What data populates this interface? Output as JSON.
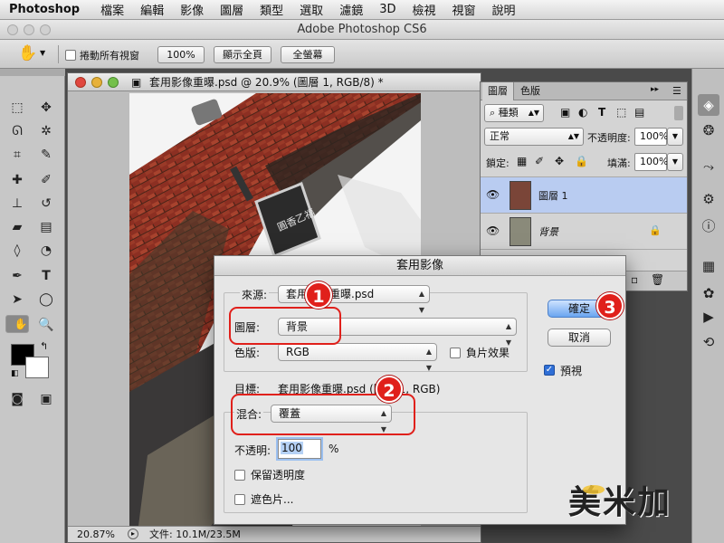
{
  "menubar": {
    "app": "Photoshop",
    "items": [
      "檔案",
      "編輯",
      "影像",
      "圖層",
      "類型",
      "選取",
      "濾鏡",
      "3D",
      "檢視",
      "視窗",
      "說明"
    ]
  },
  "window": {
    "title": "Adobe Photoshop CS6"
  },
  "options_bar": {
    "scroll_all_label": "捲動所有視窗",
    "zoom_100": "100%",
    "fit_screen": "顯示全頁",
    "fill_screen": "全螢幕"
  },
  "document": {
    "tab_title": "套用影像重曝.psd @ 20.9% (圖層 1, RGB/8) *",
    "zoom": "20.87%",
    "file_info": "文件: 10.1M/23.5M",
    "signboard_text": "圓香乙福"
  },
  "layers_panel": {
    "tab_layers": "圖層",
    "tab_channels": "色版",
    "filter_kind": "種類",
    "blend_mode": "正常",
    "opacity_label": "不透明度:",
    "opacity_value": "100%",
    "lock_label": "鎖定:",
    "fill_label": "填滿:",
    "fill_value": "100%",
    "layers": [
      {
        "name": "圖層 1"
      },
      {
        "name": "背景"
      }
    ]
  },
  "dialog": {
    "title": "套用影像",
    "source_label": "來源:",
    "source_value": "套用影像重曝.psd",
    "layer_label": "圖層:",
    "layer_value": "背景",
    "channel_label": "色版:",
    "channel_value": "RGB",
    "invert_label": "負片效果",
    "target_label": "目標:",
    "target_value": "套用影像重曝.psd (圖層 1, RGB)",
    "blending_label": "混合:",
    "blending_value": "覆蓋",
    "opacity_label": "不透明:",
    "opacity_value": "100",
    "percent": "%",
    "preserve_transparency": "保留透明度",
    "mask": "遮色片...",
    "ok": "確定",
    "cancel": "取消",
    "preview": "預視"
  },
  "badges": [
    "1",
    "2",
    "3"
  ],
  "watermark": "美米加",
  "colors": {
    "callout_red": "#e0201b",
    "selected_layer": "#b9ccf1",
    "default_button": "#6aa5f0"
  }
}
